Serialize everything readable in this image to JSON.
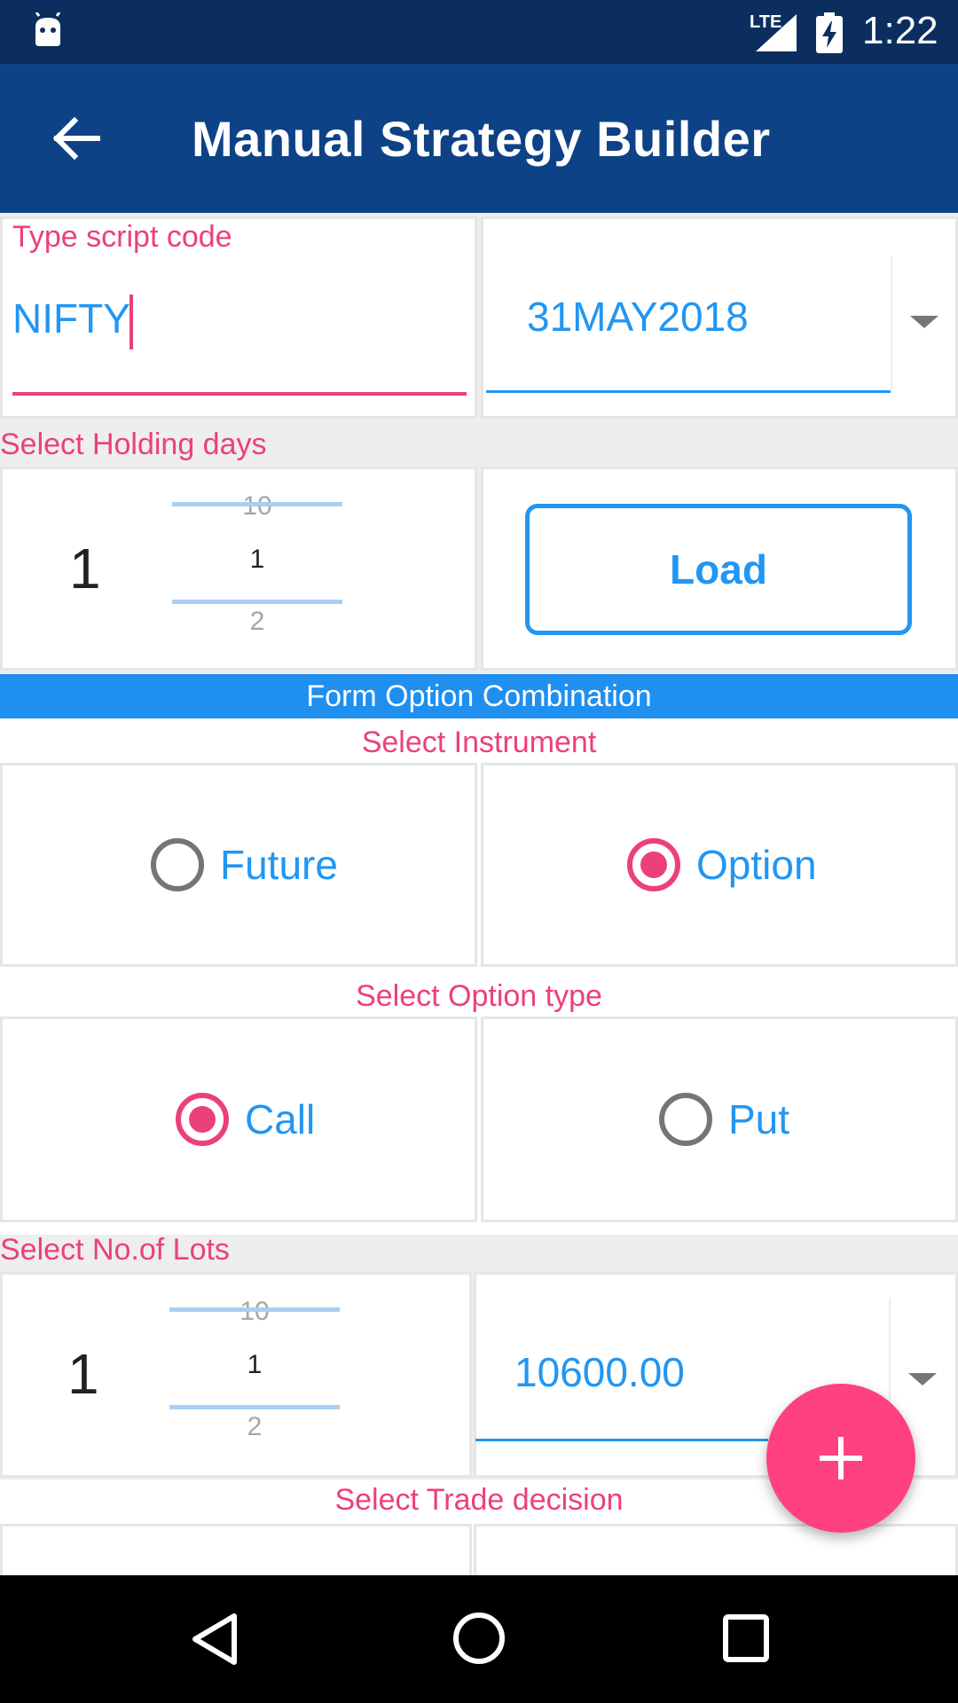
{
  "status_bar": {
    "network": "LTE",
    "time": "1:22"
  },
  "app_bar": {
    "title": "Manual Strategy Builder",
    "back_icon": "arrow-back-icon"
  },
  "script_code": {
    "label": "Type script code",
    "value": "NIFTY"
  },
  "expiry": {
    "selected": "31MAY2018"
  },
  "holding_days": {
    "label": "Select Holding days",
    "value": "1",
    "picker_prev": "10",
    "picker_current": "1",
    "picker_next": "2"
  },
  "load_button": {
    "label": "Load"
  },
  "banner": {
    "text": "Form Option Combination"
  },
  "instrument": {
    "label": "Select Instrument",
    "options": [
      "Future",
      "Option"
    ],
    "selected": "Option"
  },
  "option_type": {
    "label": "Select Option type",
    "options": [
      "Call",
      "Put"
    ],
    "selected": "Call"
  },
  "lots": {
    "label": "Select No.of Lots",
    "value": "1",
    "picker_prev": "10",
    "picker_current": "1",
    "picker_next": "2"
  },
  "strike": {
    "selected": "10600.00"
  },
  "trade_decision": {
    "label": "Select Trade decision"
  },
  "colors": {
    "app_bar": "#0e4286",
    "status_bar": "#0b2e5e",
    "accent_pink": "#ec407a",
    "fab": "#ff4081",
    "blue": "#2196f3"
  }
}
